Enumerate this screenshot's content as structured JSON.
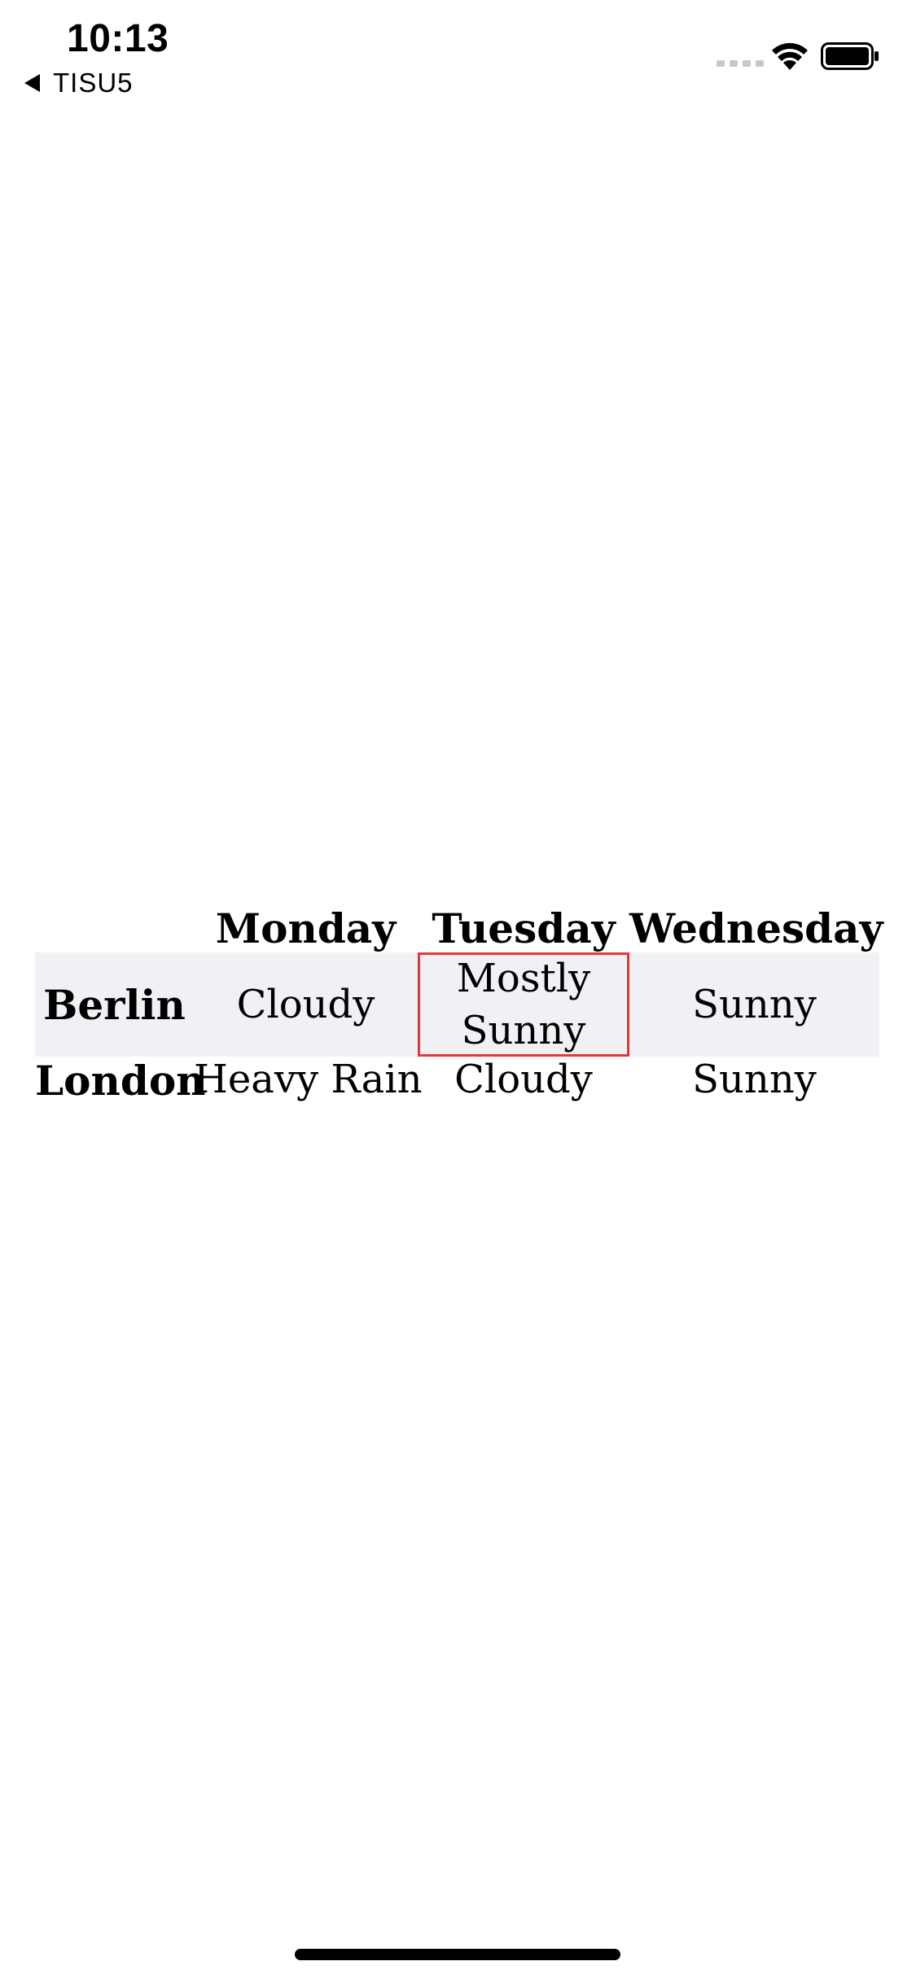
{
  "status_bar": {
    "time": "10:13",
    "back_label": "TISU5",
    "back_icon": "back-triangle-icon",
    "signal_icon": "cellular-signal-icon",
    "wifi_icon": "wifi-icon",
    "battery_icon": "battery-icon"
  },
  "table": {
    "columns": [
      "",
      "Monday",
      "Tuesday",
      "Wednesday"
    ],
    "rows": [
      {
        "header": "Berlin",
        "cells": [
          "Cloudy",
          "Mostly Sunny",
          "Sunny"
        ]
      },
      {
        "header": "London",
        "cells": [
          "Heavy Rain",
          "Cloudy",
          "Sunny"
        ]
      }
    ],
    "focused_cell_color": "#e03a36",
    "stripe_color": "#f1f0f5"
  }
}
